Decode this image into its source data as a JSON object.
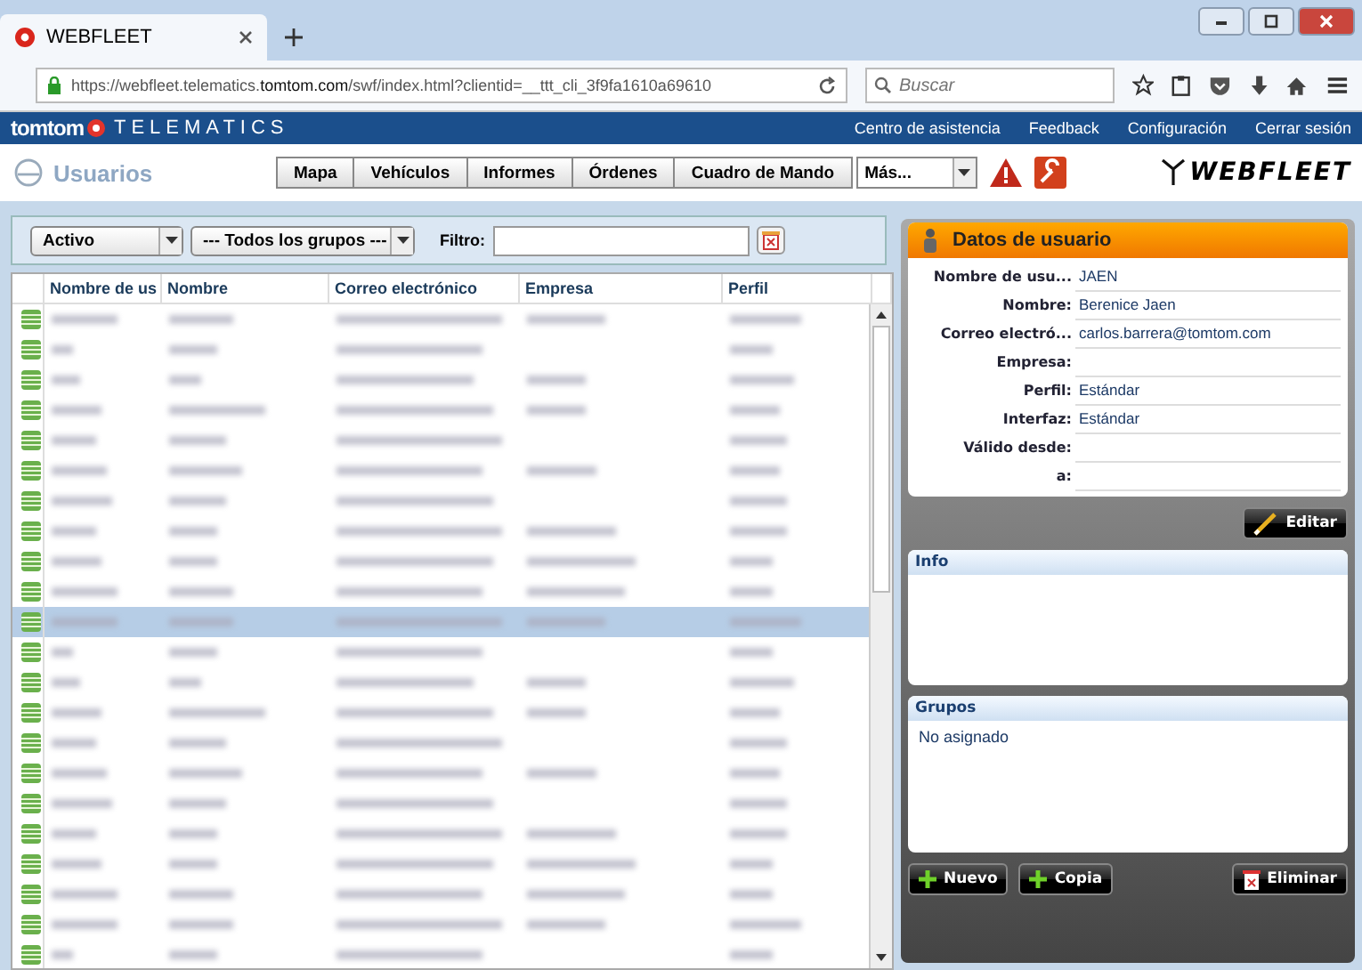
{
  "browser": {
    "tab_title": "WEBFLEET",
    "url_prefix": "https://webfleet.telematics.",
    "url_domain": "tomtom.com",
    "url_rest": "/swf/index.html?clientid=__ttt_cli_3f9fa1610a69610",
    "search_placeholder": "Buscar"
  },
  "brand": {
    "logo": "tomtom",
    "sub": "TELEMATICS",
    "links": [
      "Centro de asistencia",
      "Feedback",
      "Configuración",
      "Cerrar sesión"
    ]
  },
  "header": {
    "title": "Usuarios",
    "nav": [
      "Mapa",
      "Vehículos",
      "Informes",
      "Órdenes",
      "Cuadro de Mando"
    ],
    "more": "Más...",
    "product": "WEBFLEET"
  },
  "toolbar": {
    "status": "Activo",
    "groups": "--- Todos los grupos ---",
    "filter_label": "Filtro:"
  },
  "table": {
    "columns": [
      "Nombre de us",
      "Nombre",
      "Correo electrónico",
      "Empresa",
      "Perfil"
    ],
    "rows": [
      {
        "selected": false
      },
      {
        "selected": false
      },
      {
        "selected": false
      },
      {
        "selected": false
      },
      {
        "selected": false
      },
      {
        "selected": false
      },
      {
        "selected": false
      },
      {
        "selected": false
      },
      {
        "selected": false
      },
      {
        "selected": false
      },
      {
        "selected": true
      },
      {
        "selected": false
      },
      {
        "selected": false
      },
      {
        "selected": false
      },
      {
        "selected": false
      },
      {
        "selected": false
      },
      {
        "selected": false
      },
      {
        "selected": false
      },
      {
        "selected": false
      },
      {
        "selected": false
      },
      {
        "selected": false
      },
      {
        "selected": false
      }
    ]
  },
  "details": {
    "title": "Datos de usuario",
    "fields": [
      {
        "label": "Nombre de usu...",
        "value": "JAEN"
      },
      {
        "label": "Nombre:",
        "value": "Berenice Jaen"
      },
      {
        "label": "Correo electró...",
        "value": "carlos.barrera@tomtom.com"
      },
      {
        "label": "Empresa:"
      },
      {
        "label": "Perfil:",
        "value": "Estándar"
      },
      {
        "label": "Interfaz:",
        "value": "Estándar"
      },
      {
        "label": "Válido desde:"
      },
      {
        "label": "a:"
      }
    ],
    "edit": "Editar",
    "info_title": "Info",
    "groups_title": "Grupos",
    "groups_text": "No asignado",
    "buttons": [
      "Nuevo",
      "Copia"
    ],
    "delete": "Eliminar"
  }
}
